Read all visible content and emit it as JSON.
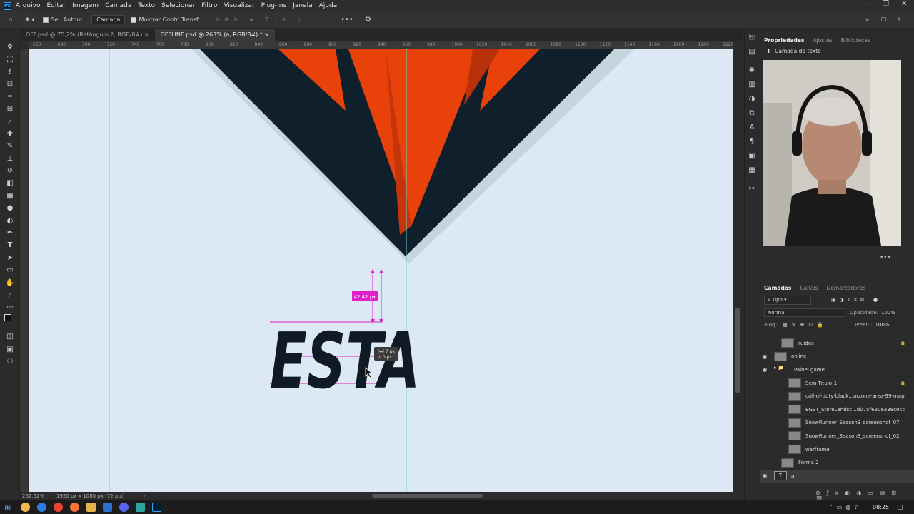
{
  "menubar": {
    "app_icon": "Ps",
    "items": [
      "Arquivo",
      "Editar",
      "Imagem",
      "Camada",
      "Texto",
      "Selecionar",
      "Filtro",
      "Visualizar",
      "Plug-ins",
      "Janela",
      "Ajuda"
    ]
  },
  "options_bar": {
    "auto_select_label": "Sel. Autom.:",
    "auto_select_target": "Camada",
    "show_transform_label": "Mostrar Contr. Transf.",
    "more": "•••"
  },
  "tabs": [
    {
      "label": "OFF.psd @ 75,2% (Retângulo 2, RGB/8#)",
      "close": "×"
    },
    {
      "label": "OFFLINE.psd @ 263% (a, RGB/8#) *",
      "close": "×"
    }
  ],
  "ruler_ticks": [
    "660",
    "680",
    "700",
    "720",
    "740",
    "760",
    "780",
    "800",
    "820",
    "840",
    "860",
    "880",
    "900",
    "920",
    "940",
    "960",
    "980",
    "1000",
    "1020",
    "1040",
    "1060",
    "1080",
    "1100",
    "1120",
    "1140",
    "1160",
    "1180",
    "1200",
    "1220"
  ],
  "canvas": {
    "text": "ESTA",
    "measure_label": "42  42 px",
    "cursor_tooltip_line1": "|↔| 7 px",
    "cursor_tooltip_line2": "↕ 0 px"
  },
  "status": {
    "zoom": "262,52%",
    "doc_size": "1920 px x 1080 px (72 ppi)"
  },
  "properties": {
    "tabs": [
      "Propriedades",
      "Ajustes",
      "Bibliotecas"
    ],
    "layer_type_label": "Camada de texto",
    "more": "•••"
  },
  "layers": {
    "tabs": [
      "Camadas",
      "Canais",
      "Demarcadores"
    ],
    "filter_label": "Tipo",
    "blend_mode": "Normal",
    "opacity_label": "Opacidade:",
    "opacity_value": "100%",
    "lock_label": "Bloq.:",
    "fill_label": "Preen.:",
    "fill_value": "100%",
    "rows": [
      {
        "name": "ruidos",
        "visible": false,
        "locked": true,
        "indent": 1
      },
      {
        "name": "online",
        "visible": true,
        "locked": false,
        "indent": 0
      },
      {
        "name": "Painel game",
        "visible": true,
        "locked": false,
        "indent": 0,
        "group": true
      },
      {
        "name": "Sem-Título-1",
        "visible": false,
        "locked": true,
        "indent": 2
      },
      {
        "name": "call-of-duty-black...arzone-area-99-map",
        "visible": false,
        "locked": false,
        "indent": 2
      },
      {
        "name": "EGST_StoreLandsc...d075f680e338c9cc",
        "visible": false,
        "locked": false,
        "indent": 2
      },
      {
        "name": "SnowRunner_Season3_screenshot_07",
        "visible": false,
        "locked": false,
        "indent": 2
      },
      {
        "name": "SnowRunner_Season3_screenshot_02",
        "visible": false,
        "locked": false,
        "indent": 2
      },
      {
        "name": "warframe",
        "visible": false,
        "locked": false,
        "indent": 2
      },
      {
        "name": "Forma 2",
        "visible": false,
        "locked": false,
        "indent": 1
      },
      {
        "name": "a",
        "visible": true,
        "locked": false,
        "indent": 0,
        "text_layer": true
      }
    ]
  },
  "taskbar": {
    "time": "08:25"
  },
  "colors": {
    "canvas_bg": "#dce9f5",
    "shape_dark": "#0f1f2b",
    "shape_orange": "#e8420a",
    "guide": "#6fd3d3",
    "smart_guide": "#e020c8"
  }
}
